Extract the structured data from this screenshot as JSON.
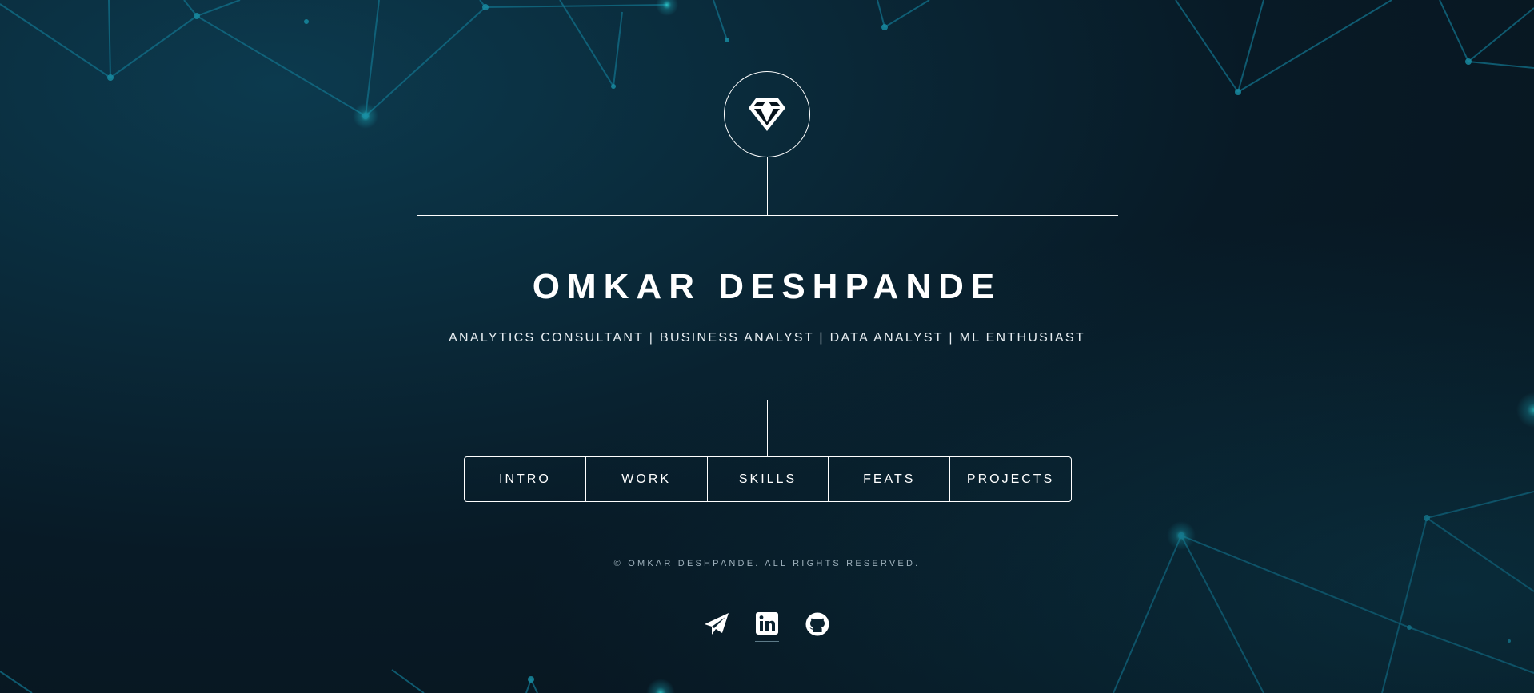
{
  "header": {
    "logo_icon": "diamond-icon",
    "name": "OMKAR DESHPANDE",
    "tagline": "ANALYTICS CONSULTANT | BUSINESS ANALYST | DATA ANALYST | ML ENTHUSIAST"
  },
  "nav": {
    "items": [
      {
        "label": "INTRO"
      },
      {
        "label": "WORK"
      },
      {
        "label": "SKILLS"
      },
      {
        "label": "FEATS"
      },
      {
        "label": "PROJECTS"
      }
    ]
  },
  "footer": {
    "copyright": "© OMKAR DESHPANDE. ALL RIGHTS RESERVED."
  },
  "social": {
    "links": [
      {
        "icon": "paper-plane-icon"
      },
      {
        "icon": "linkedin-icon"
      },
      {
        "icon": "github-icon"
      }
    ]
  },
  "colors": {
    "background": "#081a26",
    "accent": "#1aa3b3",
    "foreground": "#ffffff"
  }
}
